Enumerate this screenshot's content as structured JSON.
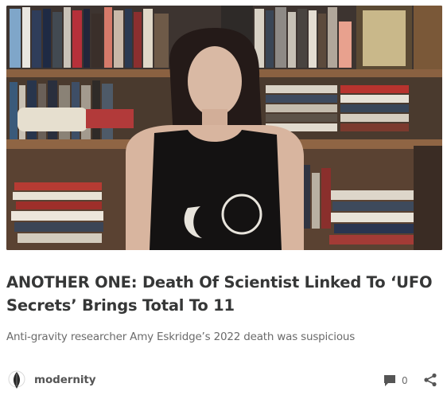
{
  "post": {
    "title": "ANOTHER ONE: Death Of Scientist Linked To ‘UFO Secrets’ Brings Total To 11",
    "subtitle": "Anti-gravity researcher Amy Eskridge’s 2022 death was suspicious"
  },
  "publication": {
    "name": "modernity",
    "logo_icon": "feather-logo-icon"
  },
  "engagement": {
    "comment_count": "0",
    "comment_icon": "comment-bubble-icon",
    "share_icon": "share-icon"
  },
  "colors": {
    "title": "#363737",
    "subtitle": "#6b6b6b",
    "icons": "#555555"
  }
}
